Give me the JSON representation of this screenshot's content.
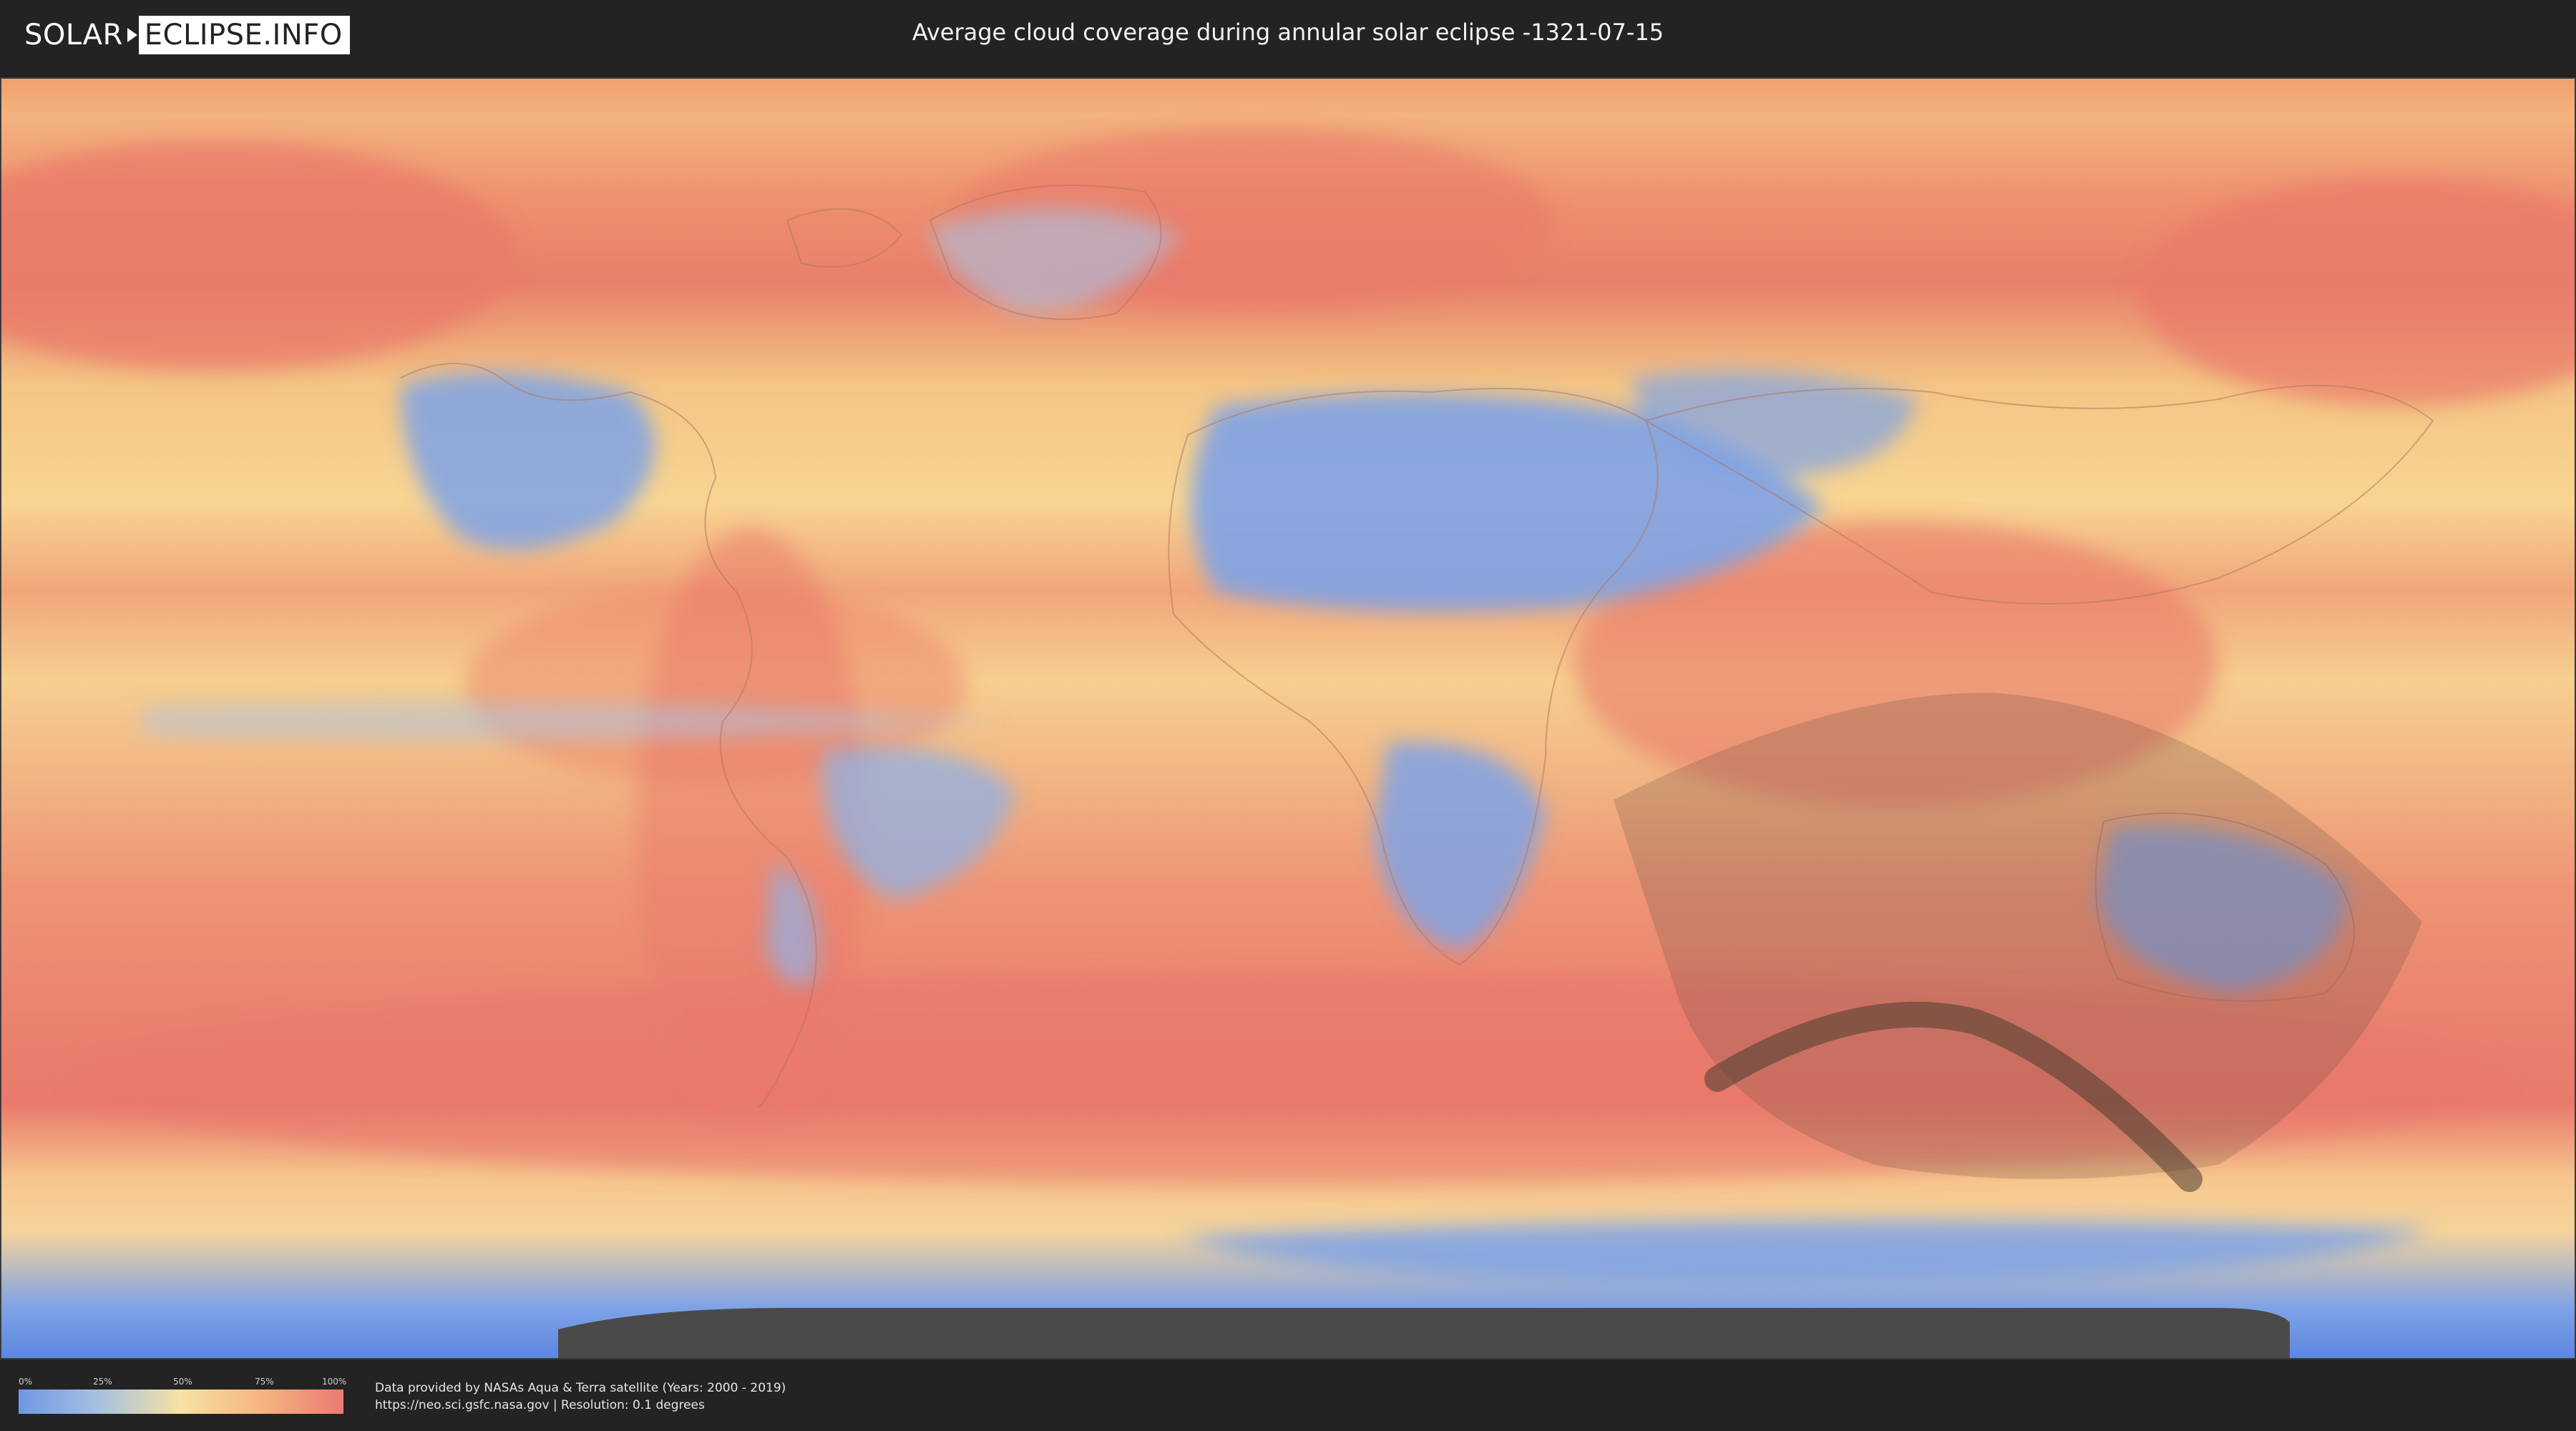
{
  "header": {
    "logo_left": "SOLAR",
    "logo_right": "ECLIPSE.INFO",
    "title": "Average cloud coverage during annular solar eclipse -1321-07-15"
  },
  "legend": {
    "ticks": [
      "0%",
      "25%",
      "50%",
      "75%",
      "100%"
    ],
    "colors": [
      "#6f98e4",
      "#a7c1e0",
      "#f6e2a3",
      "#f6b47f",
      "#ea7a72"
    ]
  },
  "footer": {
    "credit_line1": "Data provided by NASAs Aqua & Terra satellite (Years: 2000 - 2019)",
    "credit_line2": "https://neo.sci.gsfc.nasa.gov | Resolution: 0.1 degrees"
  },
  "map": {
    "palette": {
      "clear": "#7ea2e6",
      "light": "#f6e2a3",
      "cloudy": "#e9796b",
      "eclipse_shadow": "#5a4a3c",
      "nodata": "#4a4a4a"
    }
  }
}
